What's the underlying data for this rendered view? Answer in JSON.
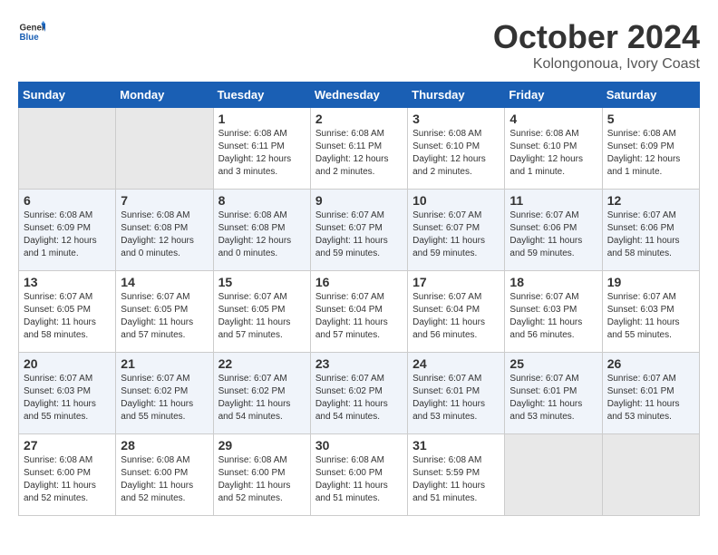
{
  "header": {
    "logo_general": "General",
    "logo_blue": "Blue",
    "month_title": "October 2024",
    "location": "Kolongonoua, Ivory Coast"
  },
  "days_of_week": [
    "Sunday",
    "Monday",
    "Tuesday",
    "Wednesday",
    "Thursday",
    "Friday",
    "Saturday"
  ],
  "weeks": [
    [
      {
        "day": "",
        "info": ""
      },
      {
        "day": "",
        "info": ""
      },
      {
        "day": "1",
        "info": "Sunrise: 6:08 AM\nSunset: 6:11 PM\nDaylight: 12 hours\nand 3 minutes."
      },
      {
        "day": "2",
        "info": "Sunrise: 6:08 AM\nSunset: 6:11 PM\nDaylight: 12 hours\nand 2 minutes."
      },
      {
        "day": "3",
        "info": "Sunrise: 6:08 AM\nSunset: 6:10 PM\nDaylight: 12 hours\nand 2 minutes."
      },
      {
        "day": "4",
        "info": "Sunrise: 6:08 AM\nSunset: 6:10 PM\nDaylight: 12 hours\nand 1 minute."
      },
      {
        "day": "5",
        "info": "Sunrise: 6:08 AM\nSunset: 6:09 PM\nDaylight: 12 hours\nand 1 minute."
      }
    ],
    [
      {
        "day": "6",
        "info": "Sunrise: 6:08 AM\nSunset: 6:09 PM\nDaylight: 12 hours\nand 1 minute."
      },
      {
        "day": "7",
        "info": "Sunrise: 6:08 AM\nSunset: 6:08 PM\nDaylight: 12 hours\nand 0 minutes."
      },
      {
        "day": "8",
        "info": "Sunrise: 6:08 AM\nSunset: 6:08 PM\nDaylight: 12 hours\nand 0 minutes."
      },
      {
        "day": "9",
        "info": "Sunrise: 6:07 AM\nSunset: 6:07 PM\nDaylight: 11 hours\nand 59 minutes."
      },
      {
        "day": "10",
        "info": "Sunrise: 6:07 AM\nSunset: 6:07 PM\nDaylight: 11 hours\nand 59 minutes."
      },
      {
        "day": "11",
        "info": "Sunrise: 6:07 AM\nSunset: 6:06 PM\nDaylight: 11 hours\nand 59 minutes."
      },
      {
        "day": "12",
        "info": "Sunrise: 6:07 AM\nSunset: 6:06 PM\nDaylight: 11 hours\nand 58 minutes."
      }
    ],
    [
      {
        "day": "13",
        "info": "Sunrise: 6:07 AM\nSunset: 6:05 PM\nDaylight: 11 hours\nand 58 minutes."
      },
      {
        "day": "14",
        "info": "Sunrise: 6:07 AM\nSunset: 6:05 PM\nDaylight: 11 hours\nand 57 minutes."
      },
      {
        "day": "15",
        "info": "Sunrise: 6:07 AM\nSunset: 6:05 PM\nDaylight: 11 hours\nand 57 minutes."
      },
      {
        "day": "16",
        "info": "Sunrise: 6:07 AM\nSunset: 6:04 PM\nDaylight: 11 hours\nand 57 minutes."
      },
      {
        "day": "17",
        "info": "Sunrise: 6:07 AM\nSunset: 6:04 PM\nDaylight: 11 hours\nand 56 minutes."
      },
      {
        "day": "18",
        "info": "Sunrise: 6:07 AM\nSunset: 6:03 PM\nDaylight: 11 hours\nand 56 minutes."
      },
      {
        "day": "19",
        "info": "Sunrise: 6:07 AM\nSunset: 6:03 PM\nDaylight: 11 hours\nand 55 minutes."
      }
    ],
    [
      {
        "day": "20",
        "info": "Sunrise: 6:07 AM\nSunset: 6:03 PM\nDaylight: 11 hours\nand 55 minutes."
      },
      {
        "day": "21",
        "info": "Sunrise: 6:07 AM\nSunset: 6:02 PM\nDaylight: 11 hours\nand 55 minutes."
      },
      {
        "day": "22",
        "info": "Sunrise: 6:07 AM\nSunset: 6:02 PM\nDaylight: 11 hours\nand 54 minutes."
      },
      {
        "day": "23",
        "info": "Sunrise: 6:07 AM\nSunset: 6:02 PM\nDaylight: 11 hours\nand 54 minutes."
      },
      {
        "day": "24",
        "info": "Sunrise: 6:07 AM\nSunset: 6:01 PM\nDaylight: 11 hours\nand 53 minutes."
      },
      {
        "day": "25",
        "info": "Sunrise: 6:07 AM\nSunset: 6:01 PM\nDaylight: 11 hours\nand 53 minutes."
      },
      {
        "day": "26",
        "info": "Sunrise: 6:07 AM\nSunset: 6:01 PM\nDaylight: 11 hours\nand 53 minutes."
      }
    ],
    [
      {
        "day": "27",
        "info": "Sunrise: 6:08 AM\nSunset: 6:00 PM\nDaylight: 11 hours\nand 52 minutes."
      },
      {
        "day": "28",
        "info": "Sunrise: 6:08 AM\nSunset: 6:00 PM\nDaylight: 11 hours\nand 52 minutes."
      },
      {
        "day": "29",
        "info": "Sunrise: 6:08 AM\nSunset: 6:00 PM\nDaylight: 11 hours\nand 52 minutes."
      },
      {
        "day": "30",
        "info": "Sunrise: 6:08 AM\nSunset: 6:00 PM\nDaylight: 11 hours\nand 51 minutes."
      },
      {
        "day": "31",
        "info": "Sunrise: 6:08 AM\nSunset: 5:59 PM\nDaylight: 11 hours\nand 51 minutes."
      },
      {
        "day": "",
        "info": ""
      },
      {
        "day": "",
        "info": ""
      }
    ]
  ]
}
